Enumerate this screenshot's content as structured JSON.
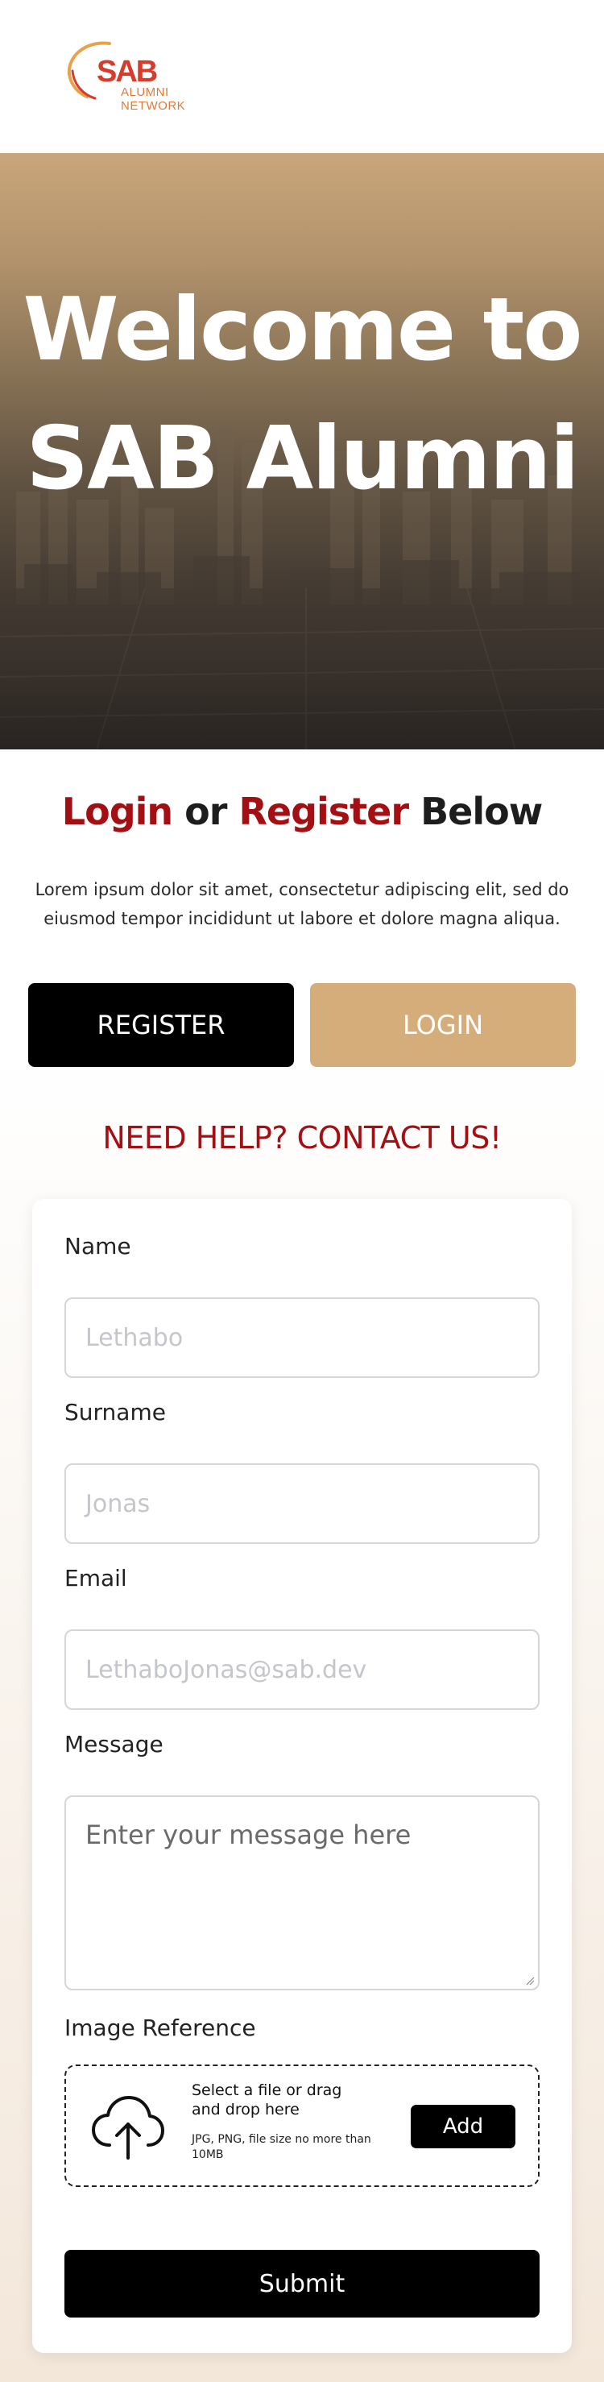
{
  "brand": {
    "logo_text": "SAB",
    "logo_line1": "ALUMNI",
    "logo_line2": "NETWORK",
    "colors": {
      "logo_red": "#d63b2b",
      "logo_orange": "#e07a3c"
    }
  },
  "hero": {
    "title_line1": "Welcome to",
    "title_line2": "SAB Alumni"
  },
  "auth": {
    "heading_login": "Login",
    "heading_or": " or ",
    "heading_register": "Register",
    "heading_below": " Below",
    "description": "Lorem ipsum dolor sit amet, consectetur adipiscing elit, sed do eiusmod tempor incididunt ut labore et dolore magna aliqua.",
    "register_label": "REGISTER",
    "login_label": "LOGIN",
    "colors": {
      "accent_red": "#a30f12",
      "login_tan": "#d4ad7a"
    }
  },
  "contact": {
    "title": "NEED HELP? CONTACT US!",
    "name_label": "Name",
    "name_placeholder": "Lethabo",
    "surname_label": "Surname",
    "surname_placeholder": "Jonas",
    "email_label": "Email",
    "email_placeholder": "LethaboJonas@sab.dev",
    "message_label": "Message",
    "message_placeholder": "Enter your message here",
    "image_label": "Image Reference",
    "upload_main": "Select a file or drag and drop here",
    "upload_sub": "JPG, PNG, file size no more than 10MB",
    "upload_icon": "cloud-upload-icon",
    "add_label": "Add",
    "submit_label": "Submit"
  }
}
